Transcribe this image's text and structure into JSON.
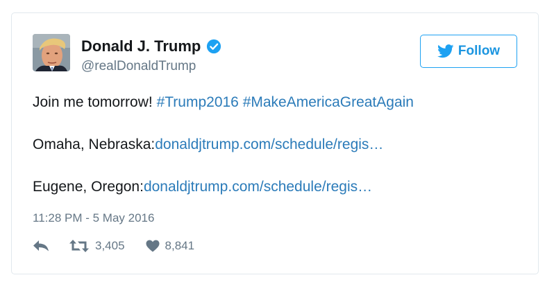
{
  "author": {
    "name": "Donald J. Trump",
    "handle": "@realDonaldTrump",
    "verified": true
  },
  "follow_button": {
    "label": "Follow"
  },
  "tweet": {
    "intro": "Join me tomorrow! ",
    "hashtags": [
      "#Trump2016",
      "#MakeAmericaGreatAgain"
    ],
    "locations": [
      {
        "place": "Omaha, Nebraska:",
        "link": "donaldjtrump.com/schedule/regis…"
      },
      {
        "place": "Eugene, Oregon:",
        "link": "donaldjtrump.com/schedule/regis…"
      }
    ]
  },
  "timestamp": "11:28 PM - 5 May 2016",
  "stats": {
    "retweets": "3,405",
    "likes": "8,841"
  },
  "colors": {
    "accent": "#1da1f2",
    "link": "#2b7bb9",
    "muted": "#657786",
    "text": "#14171a"
  }
}
